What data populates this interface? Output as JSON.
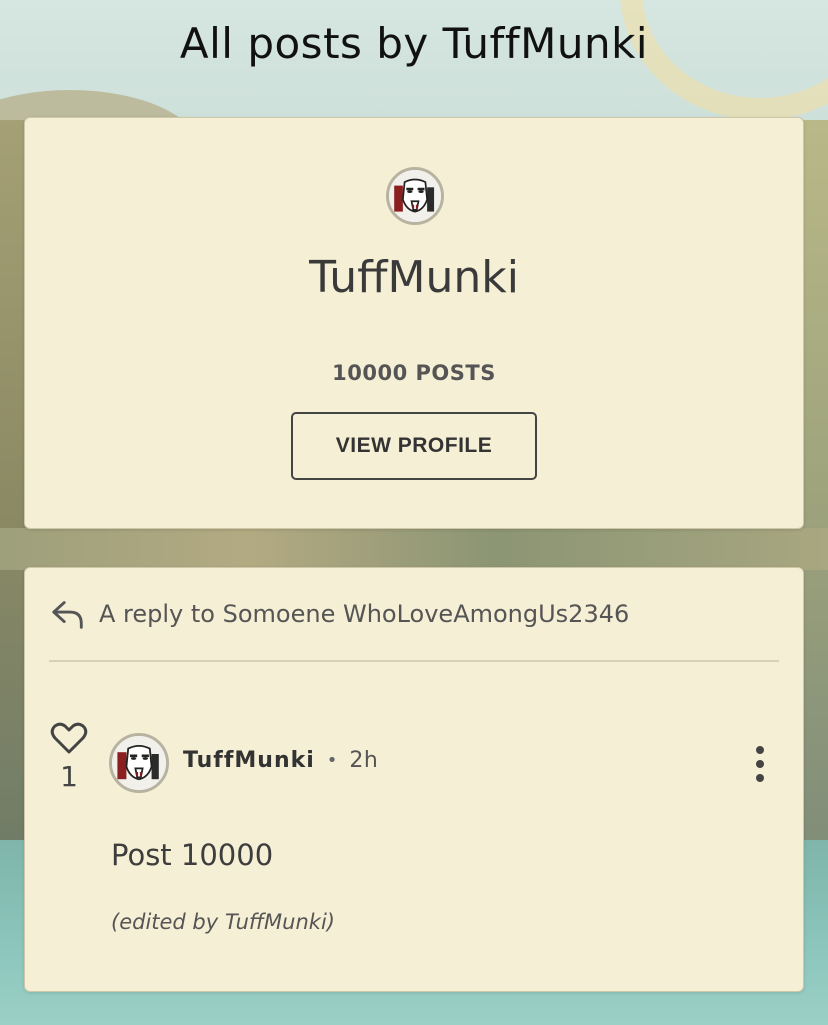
{
  "page": {
    "title": "All posts by TuffMunki"
  },
  "profile": {
    "name": "TuffMunki",
    "posts_count": "10000 POSTS",
    "view_profile_label": "VIEW PROFILE"
  },
  "post": {
    "reply_to": "A reply to Somoene WhoLoveAmongUs2346",
    "like_count": "1",
    "author": "TuffMunki",
    "separator": "•",
    "time": "2h",
    "body": "Post 10000",
    "edited_note": "(edited by TuffMunki)"
  },
  "icons": {
    "reply": "reply-arrow-icon",
    "like": "heart-outline-icon",
    "more": "vertical-ellipsis-icon"
  },
  "colors": {
    "card_background": "#f5efd5",
    "card_border": "#cfc8a8",
    "text_primary": "#3a3a3a",
    "title": "#111111"
  }
}
